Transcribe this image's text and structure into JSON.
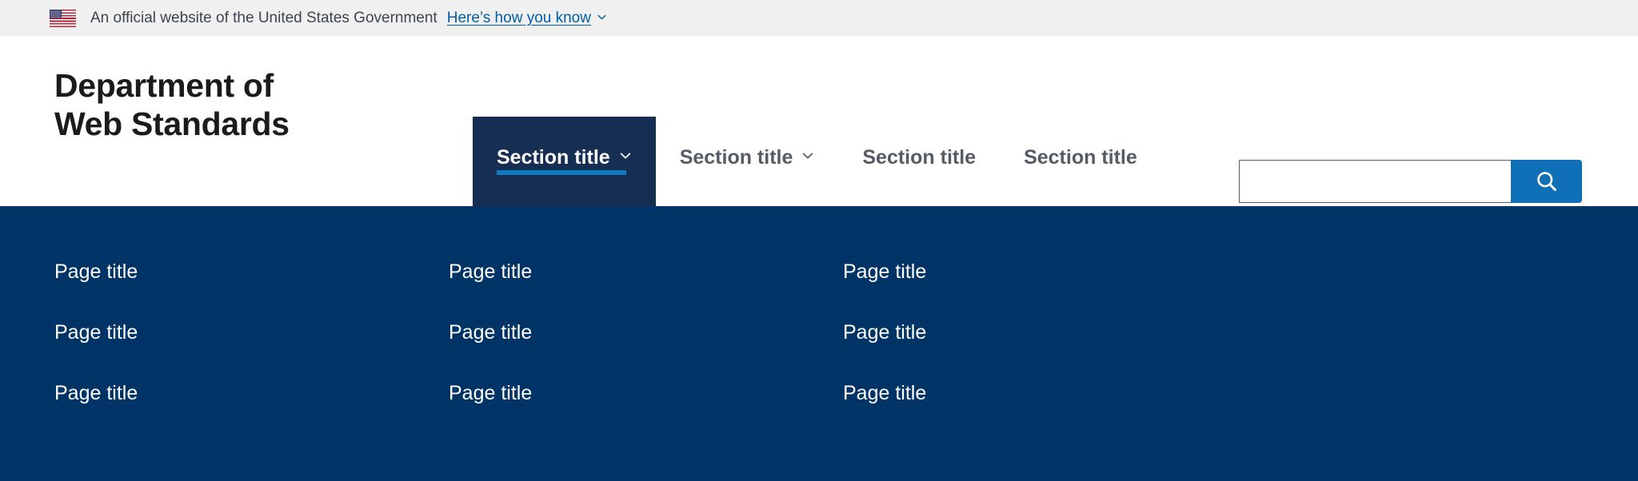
{
  "banner": {
    "flag_icon": "us-flag-icon",
    "text": "An official website of the United States Government",
    "link_label": "Here’s how you know",
    "link_chevron_icon": "chevron-down-icon",
    "background_color": "#f0f0f0",
    "link_color": "#005ea2"
  },
  "header": {
    "logo_line1": "Department of",
    "logo_line2": "Web Standards"
  },
  "nav": {
    "items": [
      {
        "label": "Section title",
        "has_chevron": true,
        "active": true,
        "chevron_icon": "chevron-down-icon"
      },
      {
        "label": "Section title",
        "has_chevron": true,
        "active": false,
        "chevron_icon": "chevron-down-icon"
      },
      {
        "label": "Section title",
        "has_chevron": false,
        "active": false,
        "chevron_icon": ""
      },
      {
        "label": "Section title",
        "has_chevron": false,
        "active": false,
        "chevron_icon": ""
      }
    ],
    "active_color": "#162e51",
    "active_underline_color": "#0f79c4",
    "inactive_text_color": "#565c65"
  },
  "search": {
    "value": "",
    "placeholder": "",
    "button_icon": "search-icon",
    "button_color": "#0f6fb7"
  },
  "mega_menu": {
    "background_color": "#003366",
    "columns": [
      {
        "links": [
          "Page title",
          "Page title",
          "Page title"
        ]
      },
      {
        "links": [
          "Page title",
          "Page title",
          "Page title"
        ]
      },
      {
        "links": [
          "Page title",
          "Page title",
          "Page title"
        ]
      }
    ]
  }
}
